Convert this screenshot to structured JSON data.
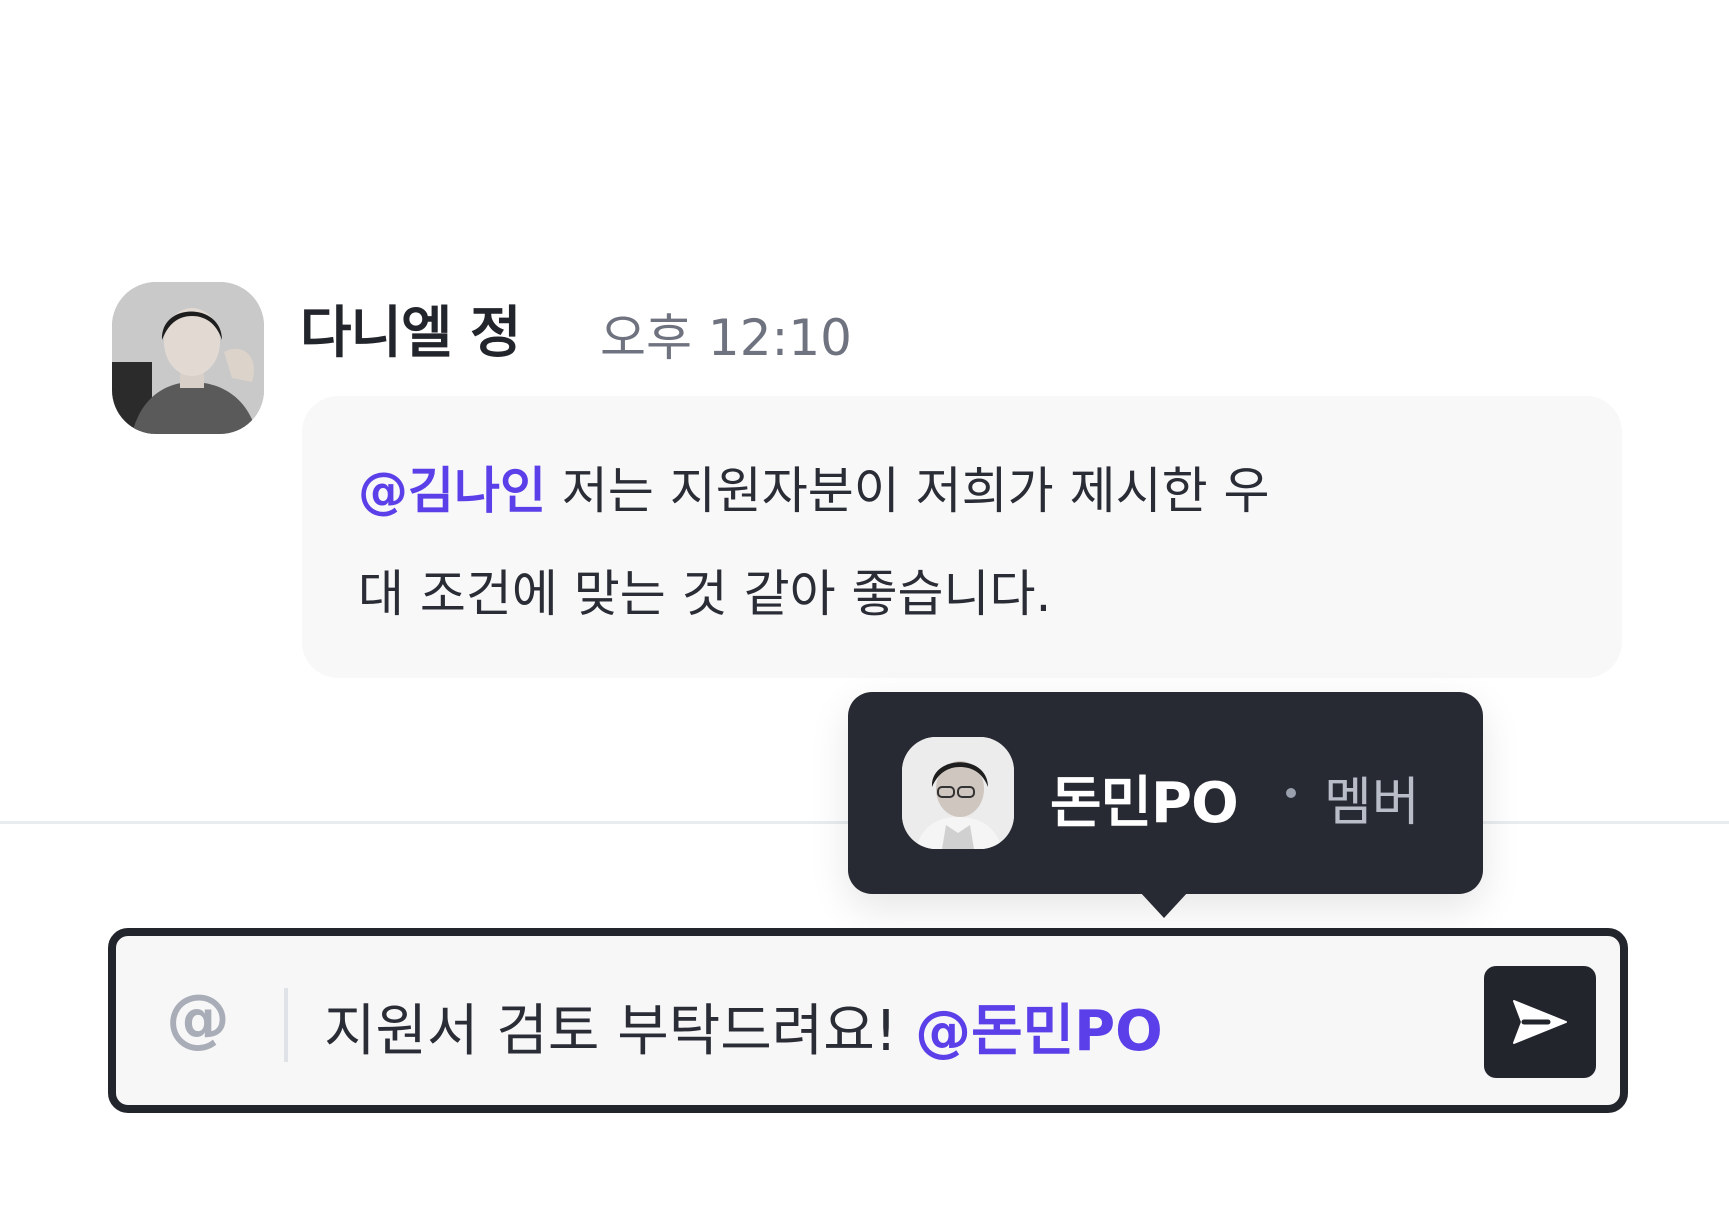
{
  "message": {
    "sender_name": "다니엘 정",
    "timestamp": "오후 12:10",
    "mention": "@김나인",
    "text_line1": " 저는 지원자분이 저희가 제시한 우",
    "text_line2": "대 조건에 맞는 것 같아 좋습니다."
  },
  "mention_popup": {
    "name": "돈민PO",
    "role": "멤버"
  },
  "composer": {
    "at_symbol": "@",
    "text": "지원서 검토 부탁드려요! ",
    "mention": "@돈민PO"
  },
  "colors": {
    "mention": "#5b3fe8",
    "dark": "#23252c",
    "bubble_bg": "#f8f8f9"
  },
  "icons": {
    "send": "send-arrow-icon",
    "at": "at-icon"
  }
}
